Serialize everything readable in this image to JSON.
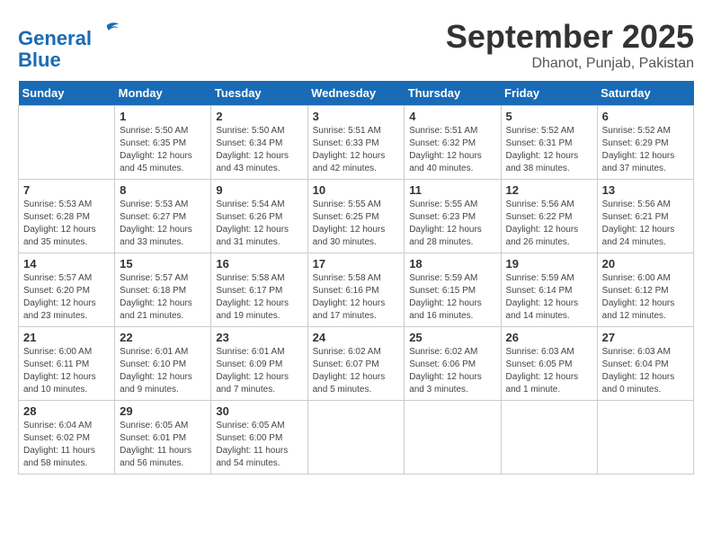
{
  "header": {
    "logo_line1": "General",
    "logo_line2": "Blue",
    "month_title": "September 2025",
    "subtitle": "Dhanot, Punjab, Pakistan"
  },
  "weekdays": [
    "Sunday",
    "Monday",
    "Tuesday",
    "Wednesday",
    "Thursday",
    "Friday",
    "Saturday"
  ],
  "weeks": [
    [
      {
        "day": "",
        "info": ""
      },
      {
        "day": "1",
        "info": "Sunrise: 5:50 AM\nSunset: 6:35 PM\nDaylight: 12 hours\nand 45 minutes."
      },
      {
        "day": "2",
        "info": "Sunrise: 5:50 AM\nSunset: 6:34 PM\nDaylight: 12 hours\nand 43 minutes."
      },
      {
        "day": "3",
        "info": "Sunrise: 5:51 AM\nSunset: 6:33 PM\nDaylight: 12 hours\nand 42 minutes."
      },
      {
        "day": "4",
        "info": "Sunrise: 5:51 AM\nSunset: 6:32 PM\nDaylight: 12 hours\nand 40 minutes."
      },
      {
        "day": "5",
        "info": "Sunrise: 5:52 AM\nSunset: 6:31 PM\nDaylight: 12 hours\nand 38 minutes."
      },
      {
        "day": "6",
        "info": "Sunrise: 5:52 AM\nSunset: 6:29 PM\nDaylight: 12 hours\nand 37 minutes."
      }
    ],
    [
      {
        "day": "7",
        "info": "Sunrise: 5:53 AM\nSunset: 6:28 PM\nDaylight: 12 hours\nand 35 minutes."
      },
      {
        "day": "8",
        "info": "Sunrise: 5:53 AM\nSunset: 6:27 PM\nDaylight: 12 hours\nand 33 minutes."
      },
      {
        "day": "9",
        "info": "Sunrise: 5:54 AM\nSunset: 6:26 PM\nDaylight: 12 hours\nand 31 minutes."
      },
      {
        "day": "10",
        "info": "Sunrise: 5:55 AM\nSunset: 6:25 PM\nDaylight: 12 hours\nand 30 minutes."
      },
      {
        "day": "11",
        "info": "Sunrise: 5:55 AM\nSunset: 6:23 PM\nDaylight: 12 hours\nand 28 minutes."
      },
      {
        "day": "12",
        "info": "Sunrise: 5:56 AM\nSunset: 6:22 PM\nDaylight: 12 hours\nand 26 minutes."
      },
      {
        "day": "13",
        "info": "Sunrise: 5:56 AM\nSunset: 6:21 PM\nDaylight: 12 hours\nand 24 minutes."
      }
    ],
    [
      {
        "day": "14",
        "info": "Sunrise: 5:57 AM\nSunset: 6:20 PM\nDaylight: 12 hours\nand 23 minutes."
      },
      {
        "day": "15",
        "info": "Sunrise: 5:57 AM\nSunset: 6:18 PM\nDaylight: 12 hours\nand 21 minutes."
      },
      {
        "day": "16",
        "info": "Sunrise: 5:58 AM\nSunset: 6:17 PM\nDaylight: 12 hours\nand 19 minutes."
      },
      {
        "day": "17",
        "info": "Sunrise: 5:58 AM\nSunset: 6:16 PM\nDaylight: 12 hours\nand 17 minutes."
      },
      {
        "day": "18",
        "info": "Sunrise: 5:59 AM\nSunset: 6:15 PM\nDaylight: 12 hours\nand 16 minutes."
      },
      {
        "day": "19",
        "info": "Sunrise: 5:59 AM\nSunset: 6:14 PM\nDaylight: 12 hours\nand 14 minutes."
      },
      {
        "day": "20",
        "info": "Sunrise: 6:00 AM\nSunset: 6:12 PM\nDaylight: 12 hours\nand 12 minutes."
      }
    ],
    [
      {
        "day": "21",
        "info": "Sunrise: 6:00 AM\nSunset: 6:11 PM\nDaylight: 12 hours\nand 10 minutes."
      },
      {
        "day": "22",
        "info": "Sunrise: 6:01 AM\nSunset: 6:10 PM\nDaylight: 12 hours\nand 9 minutes."
      },
      {
        "day": "23",
        "info": "Sunrise: 6:01 AM\nSunset: 6:09 PM\nDaylight: 12 hours\nand 7 minutes."
      },
      {
        "day": "24",
        "info": "Sunrise: 6:02 AM\nSunset: 6:07 PM\nDaylight: 12 hours\nand 5 minutes."
      },
      {
        "day": "25",
        "info": "Sunrise: 6:02 AM\nSunset: 6:06 PM\nDaylight: 12 hours\nand 3 minutes."
      },
      {
        "day": "26",
        "info": "Sunrise: 6:03 AM\nSunset: 6:05 PM\nDaylight: 12 hours\nand 1 minute."
      },
      {
        "day": "27",
        "info": "Sunrise: 6:03 AM\nSunset: 6:04 PM\nDaylight: 12 hours\nand 0 minutes."
      }
    ],
    [
      {
        "day": "28",
        "info": "Sunrise: 6:04 AM\nSunset: 6:02 PM\nDaylight: 11 hours\nand 58 minutes."
      },
      {
        "day": "29",
        "info": "Sunrise: 6:05 AM\nSunset: 6:01 PM\nDaylight: 11 hours\nand 56 minutes."
      },
      {
        "day": "30",
        "info": "Sunrise: 6:05 AM\nSunset: 6:00 PM\nDaylight: 11 hours\nand 54 minutes."
      },
      {
        "day": "",
        "info": ""
      },
      {
        "day": "",
        "info": ""
      },
      {
        "day": "",
        "info": ""
      },
      {
        "day": "",
        "info": ""
      }
    ]
  ]
}
